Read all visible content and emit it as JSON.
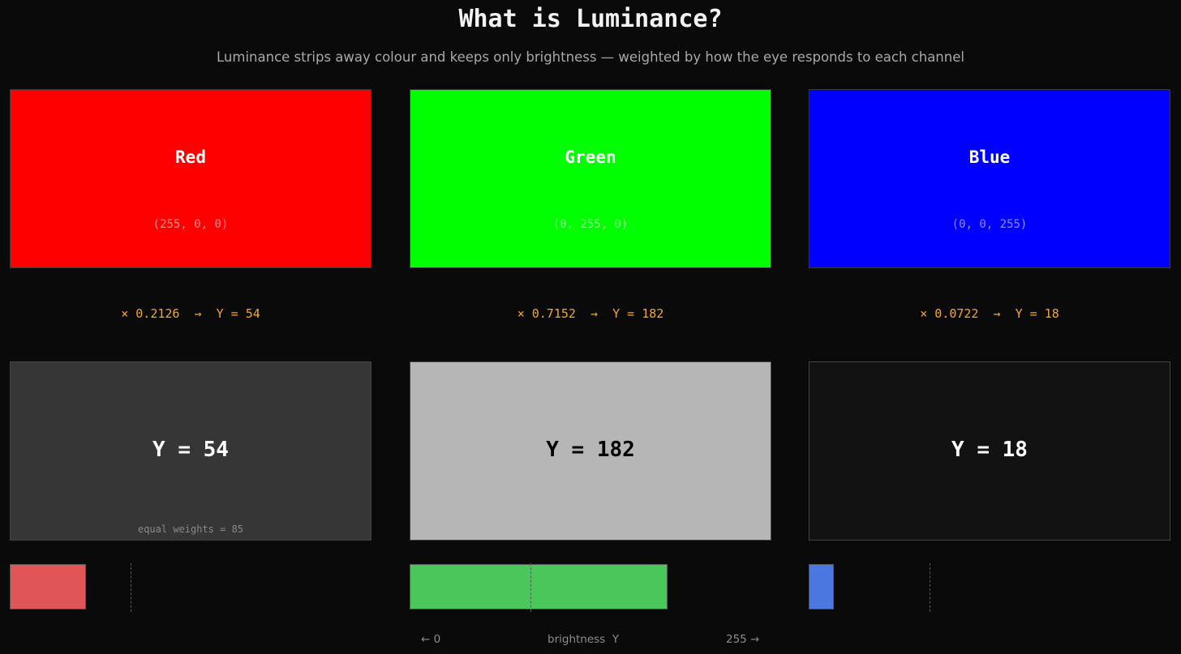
{
  "title": "What is Luminance?",
  "subtitle": "Luminance strips away colour and keeps only brightness — weighted by how the eye responds to each channel",
  "max_value": 255,
  "channels": [
    {
      "name": "Red",
      "rgb": "(255, 0, 0)",
      "swatch_color": "#ff0000",
      "formula": "× 0.2126  →  Y = 54",
      "y_label": "Y = 54",
      "y_value": 54,
      "gray_color": "#363636",
      "gray_text_color": "#ffffff",
      "note": "equal weights = 85",
      "equal_weight_value": 85,
      "bar_color": "#e05555"
    },
    {
      "name": "Green",
      "rgb": "(0, 255, 0)",
      "swatch_color": "#00ff00",
      "formula": "× 0.7152  →  Y = 182",
      "y_label": "Y = 182",
      "y_value": 182,
      "gray_color": "#b6b6b6",
      "gray_text_color": "#000000",
      "note": "",
      "equal_weight_value": 85,
      "bar_color": "#4ac65a"
    },
    {
      "name": "Blue",
      "rgb": "(0, 0, 255)",
      "swatch_color": "#0000ff",
      "formula": "× 0.0722  →  Y = 18",
      "y_label": "Y = 18",
      "y_value": 18,
      "gray_color": "#121212",
      "gray_text_color": "#ffffff",
      "note": "",
      "equal_weight_value": 85,
      "bar_color": "#4a78e0"
    }
  ],
  "axis": {
    "left": "← 0",
    "center": "brightness  Y",
    "right": "255 →"
  }
}
